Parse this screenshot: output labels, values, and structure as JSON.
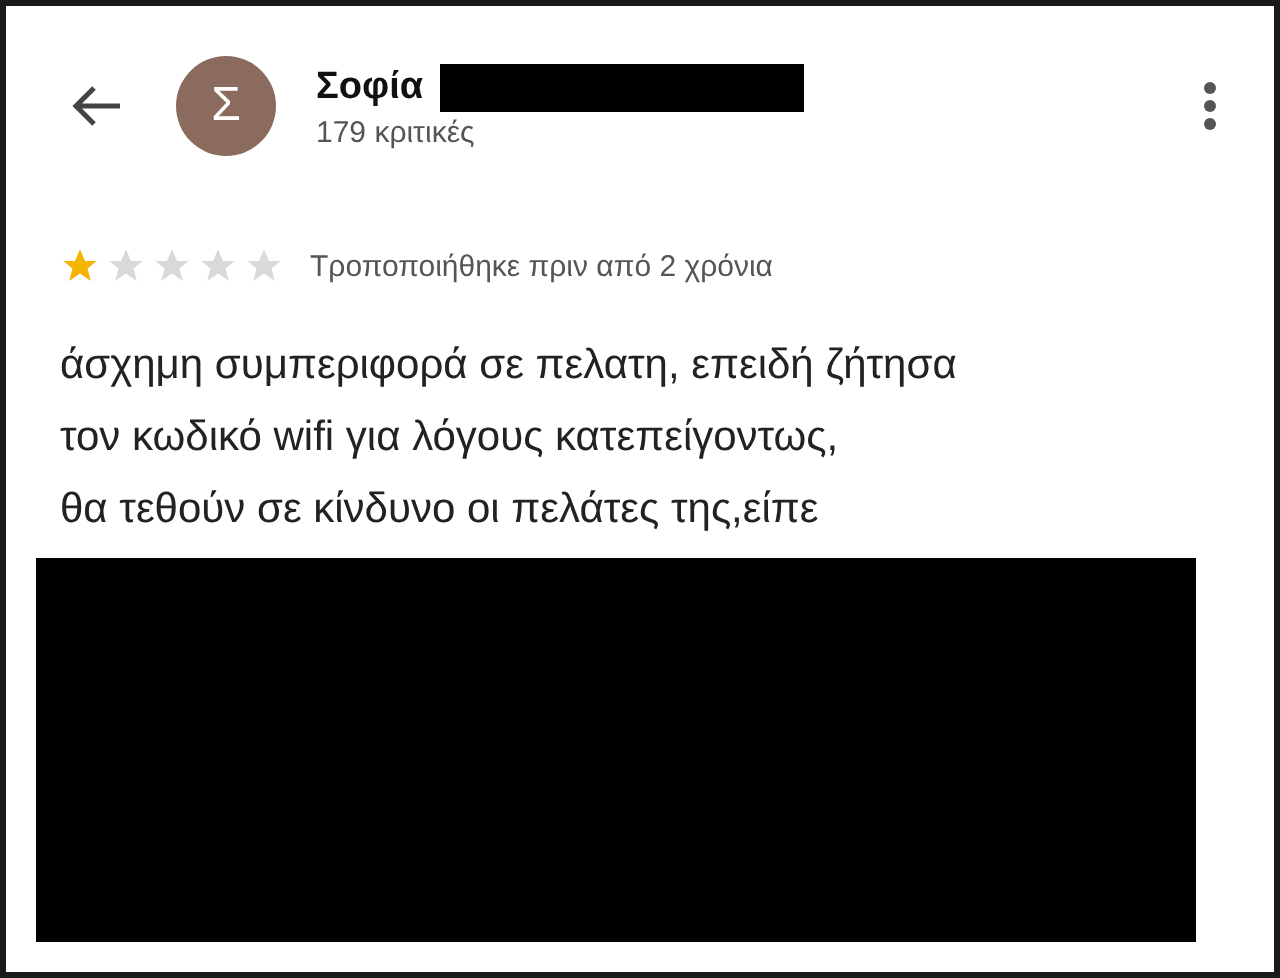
{
  "reviewer": {
    "avatar_letter": "Σ",
    "name": "Σοφία",
    "review_count": "179 κριτικές"
  },
  "review": {
    "stars": 1,
    "date": "Τροποποιήθηκε πριν από 2 χρόνια",
    "lines": [
      "άσχημη συμπεριφορά σε πελατη, επειδή ζήτησα",
      "τον κωδικό wifi για λόγους κατεπείγοντως,",
      "θα τεθούν σε κίνδυνο οι πελάτες της,είπε"
    ]
  }
}
